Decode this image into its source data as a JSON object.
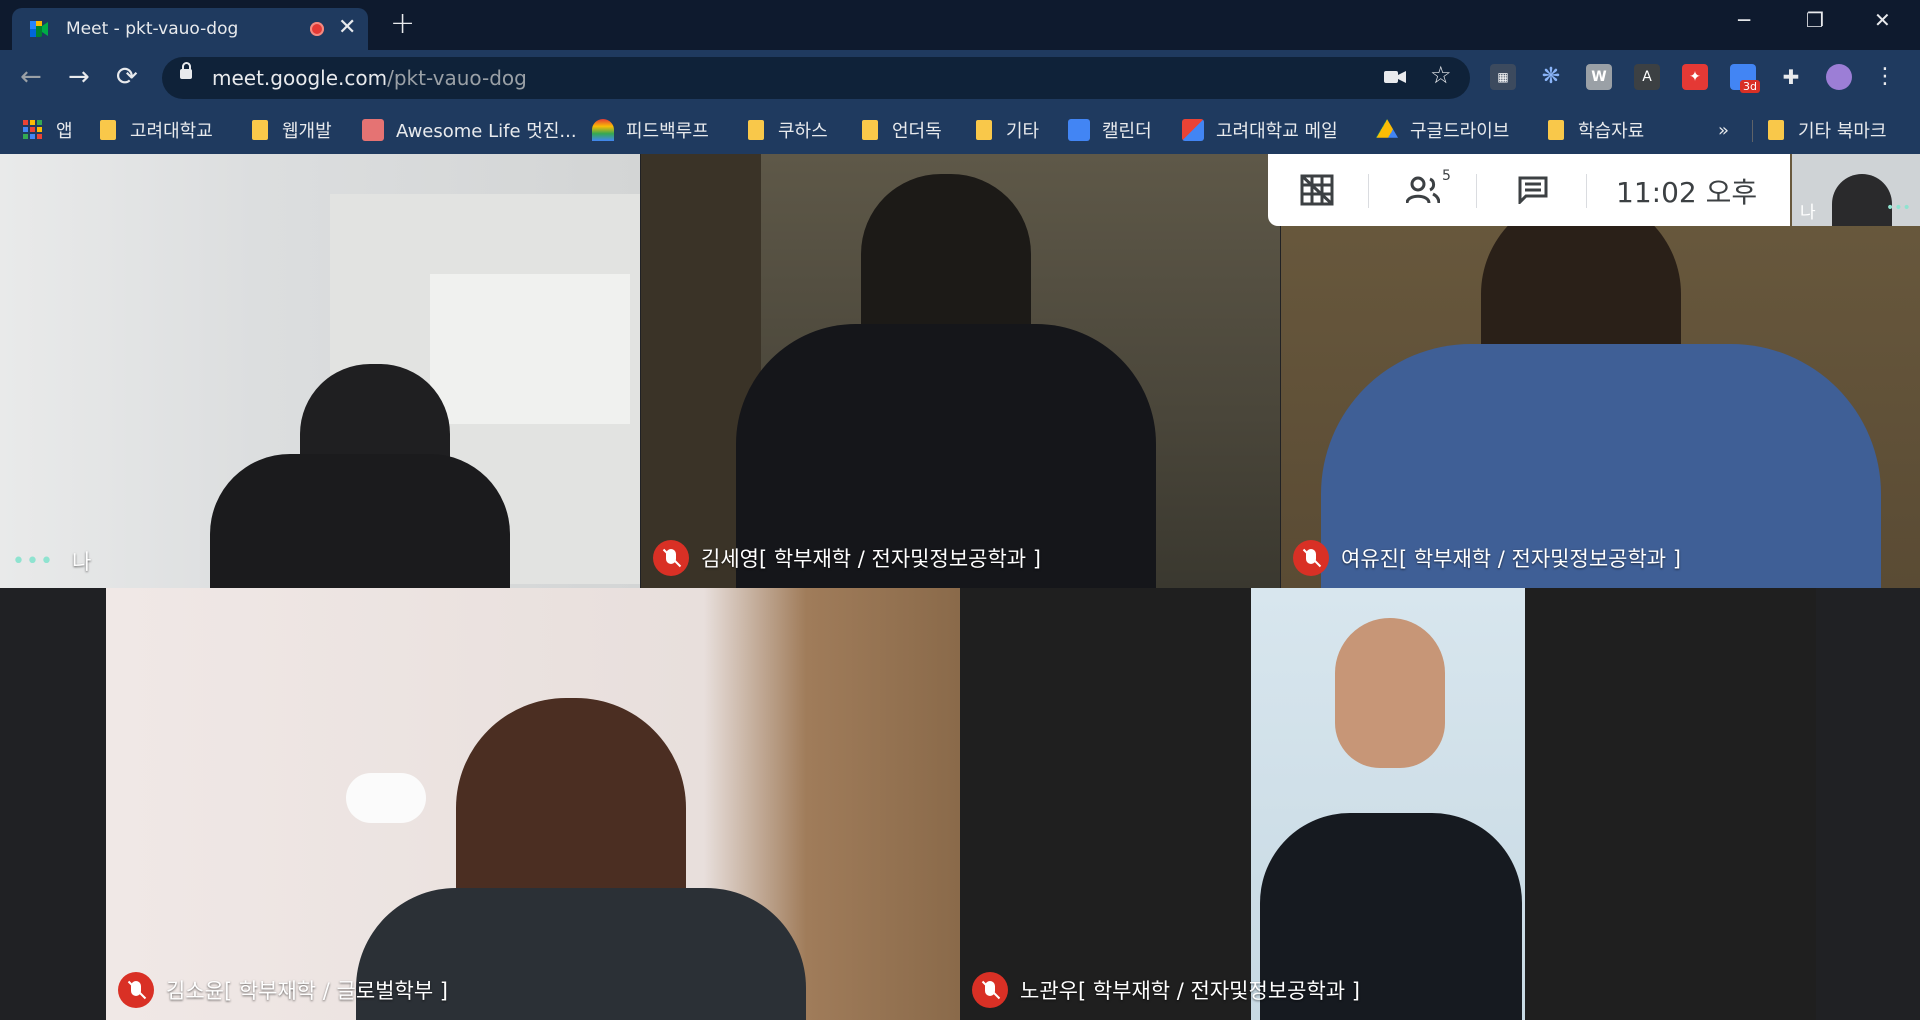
{
  "browser": {
    "tab_title": "Meet - pkt-vauo-dog",
    "tab_close": "✕",
    "new_tab": "+",
    "window_minimize": "─",
    "window_restore": "❐",
    "window_close": "✕",
    "url_host": "meet.google.com",
    "url_path": "/pkt-vauo-dog"
  },
  "bookmarks": [
    {
      "label": "앱",
      "icon": "apps-grid-icon"
    },
    {
      "label": "고려대학교",
      "icon": "folder-icon"
    },
    {
      "label": "웹개발",
      "icon": "folder-icon"
    },
    {
      "label": "Awesome Life 멋진...",
      "icon": "gift-icon"
    },
    {
      "label": "피드백루프",
      "icon": "rainbow-icon"
    },
    {
      "label": "쿠하스",
      "icon": "folder-icon"
    },
    {
      "label": "언더독",
      "icon": "folder-icon"
    },
    {
      "label": "기타",
      "icon": "folder-icon"
    },
    {
      "label": "캘린더",
      "icon": "calendar-icon"
    },
    {
      "label": "고려대학교 메일",
      "icon": "gmail-icon"
    },
    {
      "label": "구글드라이브",
      "icon": "drive-icon"
    },
    {
      "label": "학습자료",
      "icon": "folder-icon"
    }
  ],
  "bookmarks_more": "»",
  "other_bookmarks": "기타 북마크",
  "extensions": {
    "calendar_badge": "3d"
  },
  "meet": {
    "participants_count": "5",
    "clock": "11:02 오후",
    "self_label": "나",
    "tiles": [
      {
        "name": "나",
        "muted": false
      },
      {
        "name": "김세영[ 학부재학 / 전자및정보공학과 ]",
        "muted": true
      },
      {
        "name": "여유진[ 학부재학 / 전자및정보공학과 ]",
        "muted": true
      },
      {
        "name": "김소윤[ 학부재학 / 글로벌학부 ]",
        "muted": true
      },
      {
        "name": "노관우[ 학부재학 / 전자및정보공학과 ]",
        "muted": true
      }
    ]
  }
}
